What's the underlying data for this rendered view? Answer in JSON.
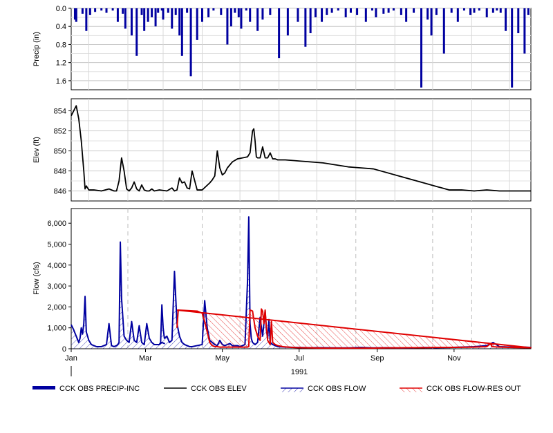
{
  "chart_data": {
    "type": "line",
    "x_axis": {
      "ticks": [
        "Jan",
        "Mar",
        "May",
        "Jul",
        "Sep",
        "Nov"
      ],
      "year_label": "1991",
      "range": [
        "1991-01-01",
        "1991-12-31"
      ]
    },
    "panels": [
      {
        "type": "bar",
        "ylabel": "Precip (in)",
        "y_inverted": true,
        "ylim": [
          0,
          1.8
        ],
        "ticks": [
          "0.0",
          "0.4",
          "0.8",
          "1.2",
          "1.6"
        ],
        "tick_values": [
          0,
          0.4,
          0.8,
          1.2,
          1.6
        ],
        "series": [
          {
            "name": "CCK OBS PRECIP-INC",
            "color": "#0000a0",
            "x": [
              3,
              4,
              9,
              12,
              15,
              19,
              24,
              28,
              33,
              37,
              41,
              43,
              48,
              52,
              56,
              58,
              61,
              64,
              67,
              69,
              72,
              73,
              77,
              80,
              83,
              86,
              88,
              92,
              95,
              100,
              104,
              109,
              113,
              119,
              124,
              127,
              130,
              133,
              135,
              139,
              142,
              148,
              152,
              158,
              165,
              172,
              180,
              186,
              190,
              194,
              199,
              203,
              207,
              212,
              218,
              222,
              227,
              234,
              239,
              242,
              248,
              252,
              256,
              262,
              266,
              272,
              278,
              283,
              286,
              290,
              296,
              302,
              307,
              312,
              317,
              320,
              324,
              330,
              335,
              338,
              341,
              345,
              350,
              355,
              360,
              363
            ],
            "values": [
              0.25,
              0.3,
              0.12,
              0.5,
              0.15,
              0.08,
              0.05,
              0.1,
              0.05,
              0.3,
              0.12,
              0.45,
              0.6,
              1.05,
              0.15,
              0.5,
              0.3,
              0.2,
              0.4,
              0.1,
              0.05,
              0.25,
              0.1,
              0.45,
              0.15,
              0.6,
              1.05,
              0.1,
              1.5,
              0.7,
              0.3,
              0.2,
              0.05,
              0.15,
              0.8,
              0.4,
              0.1,
              0.2,
              0.45,
              0.05,
              0.3,
              0.5,
              0.25,
              0.15,
              1.1,
              0.6,
              0.3,
              0.85,
              0.55,
              0.2,
              0.3,
              0.15,
              0.1,
              0.05,
              0.2,
              0.1,
              0.15,
              0.3,
              0.05,
              0.2,
              0.12,
              0.1,
              0.05,
              0.15,
              0.3,
              0.1,
              1.75,
              0.25,
              0.6,
              0.15,
              1.0,
              0.1,
              0.3,
              0.05,
              0.15,
              0.1,
              0.05,
              0.2,
              0.1,
              0.05,
              0.1,
              0.5,
              1.75,
              0.55,
              1.0,
              0.15
            ]
          }
        ]
      },
      {
        "type": "line",
        "ylabel": "Elev (ft)",
        "ylim": [
          845,
          855.2
        ],
        "ticks": [
          "846",
          "848",
          "850",
          "852",
          "854"
        ],
        "tick_values": [
          846,
          848,
          850,
          852,
          854
        ],
        "series": [
          {
            "name": "CCK OBS ELEV",
            "color": "#000000",
            "x": [
              0,
              2,
              4,
              6,
              8,
              10,
              11,
              12,
              14,
              18,
              24,
              30,
              34,
              36,
              38,
              40,
              42,
              44,
              46,
              48,
              50,
              52,
              54,
              56,
              58,
              60,
              62,
              64,
              66,
              70,
              76,
              80,
              82,
              84,
              86,
              88,
              90,
              92,
              94,
              96,
              100,
              104,
              110,
              112,
              114,
              116,
              118,
              120,
              122,
              124,
              126,
              128,
              132,
              136,
              140,
              142,
              144,
              145,
              146,
              147,
              148,
              150,
              152,
              154,
              156,
              158,
              160,
              162,
              164,
              166,
              170,
              180,
              200,
              220,
              240,
              260,
              280,
              300,
              310,
              320,
              330,
              340,
              350,
              360,
              365
            ],
            "values": [
              853.5,
              854.0,
              854.5,
              853.2,
              851.0,
              848.0,
              846.2,
              846.5,
              846.1,
              846.1,
              846.0,
              846.2,
              846.0,
              846.0,
              847.0,
              849.3,
              848.0,
              846.2,
              846.0,
              846.3,
              846.9,
              846.2,
              846.0,
              846.6,
              846.1,
              846.0,
              846.0,
              846.2,
              846.0,
              846.1,
              846.0,
              846.3,
              846.0,
              846.1,
              847.3,
              846.8,
              846.9,
              846.3,
              846.2,
              848.0,
              846.1,
              846.1,
              846.8,
              847.1,
              847.5,
              850.0,
              848.3,
              847.6,
              847.8,
              848.3,
              848.6,
              848.9,
              849.2,
              849.3,
              849.4,
              849.8,
              852.0,
              852.2,
              851.0,
              849.4,
              849.3,
              849.3,
              850.4,
              849.3,
              849.3,
              849.8,
              849.2,
              849.2,
              849.1,
              849.1,
              849.1,
              849.0,
              848.8,
              848.4,
              848.2,
              847.5,
              846.8,
              846.1,
              846.1,
              846.0,
              846.1,
              846.0,
              846.0,
              846.0,
              846.0
            ]
          }
        ]
      },
      {
        "type": "line",
        "ylabel": "Flow (cfs)",
        "ylim": [
          0,
          6700
        ],
        "ticks": [
          "0",
          "1,000",
          "2,000",
          "3,000",
          "4,000",
          "5,000",
          "6,000"
        ],
        "tick_values": [
          0,
          1000,
          2000,
          3000,
          4000,
          5000,
          6000
        ],
        "series": [
          {
            "name": "CCK OBS FLOW",
            "color": "#0000a0",
            "x": [
              0,
              2,
              4,
              6,
              7,
              8,
              9,
              10,
              11,
              12,
              14,
              16,
              18,
              20,
              24,
              28,
              30,
              32,
              34,
              36,
              37,
              38,
              39,
              40,
              42,
              44,
              46,
              48,
              50,
              52,
              54,
              56,
              58,
              60,
              62,
              64,
              66,
              68,
              70,
              72,
              74,
              72,
              70,
              71,
              72,
              73,
              74,
              76,
              78,
              80,
              82,
              84,
              86,
              88,
              90,
              92,
              94,
              96,
              100,
              104,
              106,
              108,
              110,
              112,
              114,
              116,
              118,
              120,
              122,
              124,
              126,
              128,
              130,
              132,
              134,
              136,
              138,
              140,
              141,
              142,
              143,
              144,
              146,
              148,
              150,
              152,
              154,
              155,
              156,
              157,
              158,
              160,
              164,
              170,
              180,
              190,
              200,
              210,
              220,
              230,
              240,
              250,
              260,
              270,
              280,
              290,
              300,
              310,
              320,
              330,
              335,
              340,
              350,
              360,
              365
            ],
            "values": [
              1150,
              900,
              600,
              300,
              500,
              1000,
              700,
              1200,
              2500,
              800,
              400,
              200,
              150,
              100,
              100,
              200,
              1200,
              150,
              100,
              150,
              200,
              300,
              5100,
              2400,
              600,
              400,
              300,
              1300,
              400,
              300,
              1100,
              300,
              200,
              1200,
              500,
              300,
              200,
              200,
              200,
              300,
              250,
              300,
              200,
              300,
              2100,
              1000,
              500,
              600,
              300,
              400,
              3700,
              1200,
              600,
              300,
              200,
              150,
              100,
              100,
              150,
              200,
              2300,
              1000,
              400,
              300,
              200,
              150,
              400,
              200,
              150,
              200,
              250,
              150,
              150,
              150,
              100,
              150,
              200,
              3200,
              6300,
              1200,
              500,
              300,
              200,
              300,
              1500,
              600,
              1800,
              900,
              500,
              1400,
              300,
              200,
              100,
              80,
              60,
              50,
              50,
              40,
              40,
              60,
              40,
              50,
              40,
              40,
              60,
              50,
              60,
              80,
              100,
              150,
              300,
              100,
              80,
              80,
              60
            ],
            "hatched": true
          },
          {
            "name": "CCK OBS FLOW-RES OUT",
            "color": "#e00000",
            "x": [
              84,
              85,
              100,
              104,
              105,
              106,
              108,
              110,
              112,
              114,
              116,
              118,
              120,
              122,
              124,
              126,
              128,
              130,
              132,
              134,
              136,
              138,
              140,
              141,
              142,
              144,
              146,
              148,
              150,
              151,
              152,
              153,
              154,
              155,
              156,
              157,
              158,
              159,
              160,
              162,
              164,
              168,
              172,
              176,
              180,
              190,
              200,
              210,
              220,
              230,
              240,
              250,
              260,
              270,
              280,
              290,
              300,
              310,
              320,
              330,
              333,
              334,
              340,
              350,
              360,
              365,
              333,
              84
            ],
            "values": [
              1000,
              1850,
              1800,
              1700,
              1500,
              1300,
              800,
              300,
              150,
              100,
              100,
              80,
              80,
              80,
              80,
              80,
              80,
              80,
              80,
              80,
              80,
              80,
              80,
              100,
              1850,
              1800,
              1000,
              600,
              400,
              1900,
              1800,
              1200,
              1850,
              1000,
              400,
              300,
              200,
              1300,
              300,
              200,
              150,
              100,
              80,
              60,
              50,
              40,
              30,
              30,
              30,
              30,
              30,
              40,
              40,
              50,
              50,
              60,
              60,
              70,
              80,
              100,
              250,
              100,
              80,
              60,
              50,
              50,
              250,
              1850
            ],
            "hatched": true
          }
        ]
      }
    ],
    "legend": {
      "placement": "bottom",
      "entries": [
        "CCK OBS PRECIP-INC",
        "CCK OBS ELEV",
        "CCK OBS FLOW",
        "CCK OBS FLOW-RES OUT"
      ]
    },
    "grid": true
  }
}
